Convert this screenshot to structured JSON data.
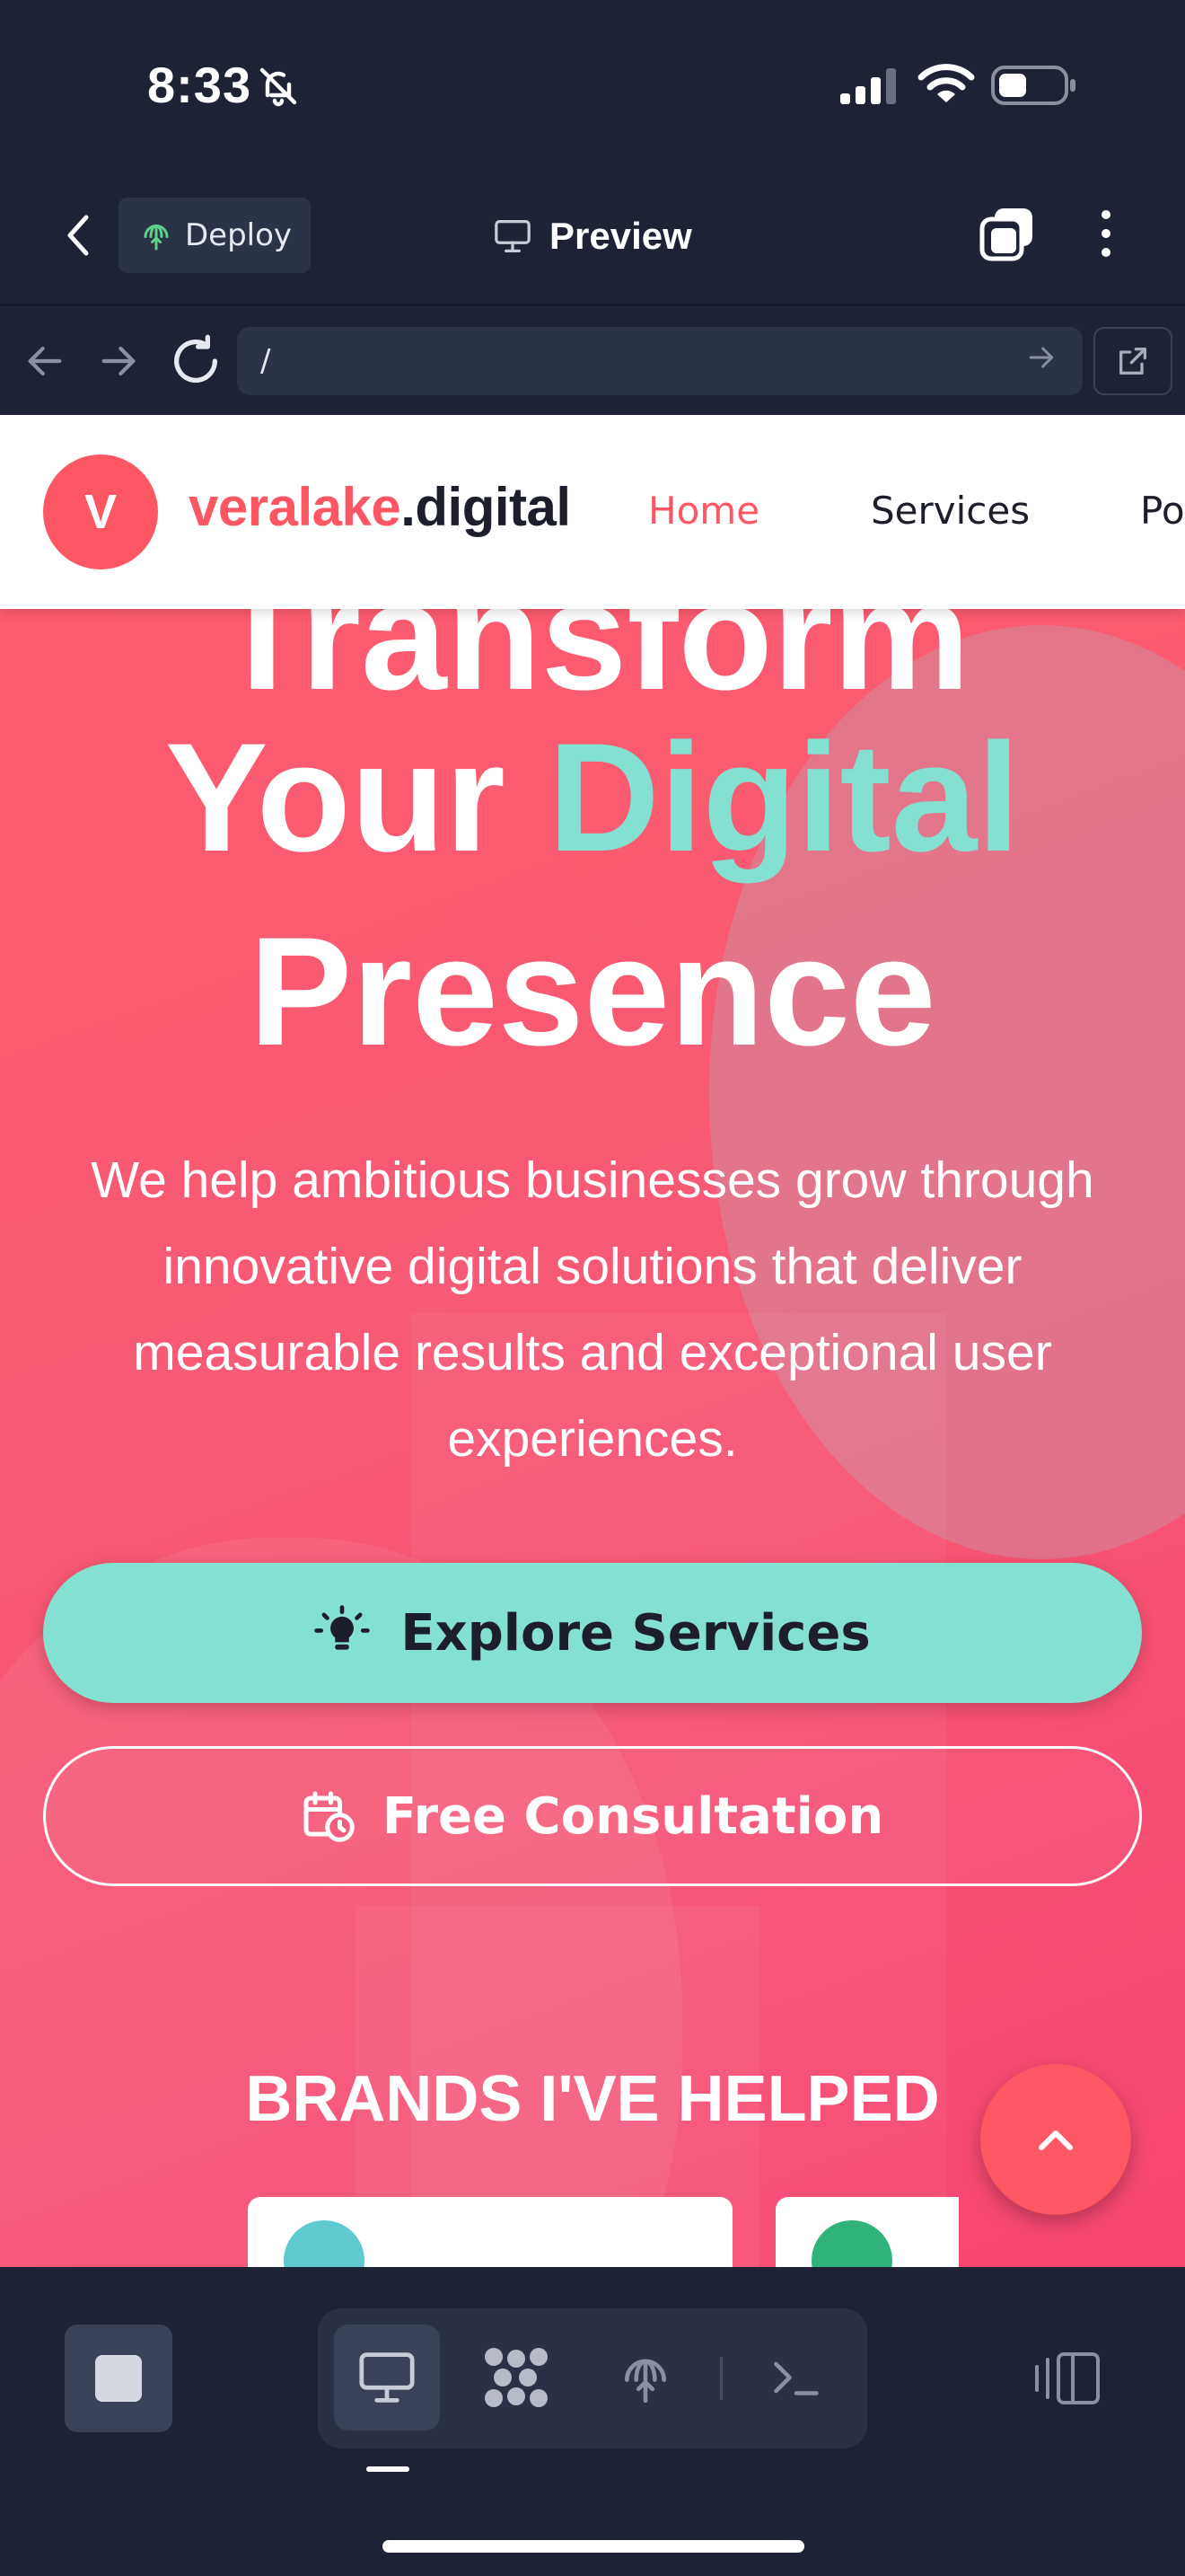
{
  "status_bar": {
    "time": "8:33"
  },
  "toolbar": {
    "deploy_label": "Deploy",
    "preview_label": "Preview"
  },
  "address_bar": {
    "url": "/"
  },
  "site": {
    "logo_letter": "V",
    "logo_name_accent": "veralake",
    "logo_name_rest": ".digital",
    "nav": {
      "home": "Home",
      "services": "Services",
      "portfolio": "Po"
    },
    "hero": {
      "line1": "Transform",
      "line2_plain": "Your ",
      "line2_accent": "Digital",
      "line3": "Presence",
      "subtitle": "We help ambitious businesses grow through innovative digital solutions that deliver measurable results and exceptional user experiences."
    },
    "explore_label": "Explore Services",
    "consult_label": "Free Consultation",
    "brands_heading": "BRANDS I'VE HELPED"
  },
  "colors": {
    "brand": "#fc5763",
    "accent": "#84e0d0",
    "chrome_bg": "#1d2335",
    "chrome_panel": "#2b3347"
  },
  "icons": {
    "bell": "bell-slash-icon",
    "deploy": "deploy-icon",
    "preview": "monitor-icon",
    "explore": "lightbulb-icon",
    "consult": "calendar-clock-icon",
    "scroll_top": "chevron-up-icon"
  }
}
